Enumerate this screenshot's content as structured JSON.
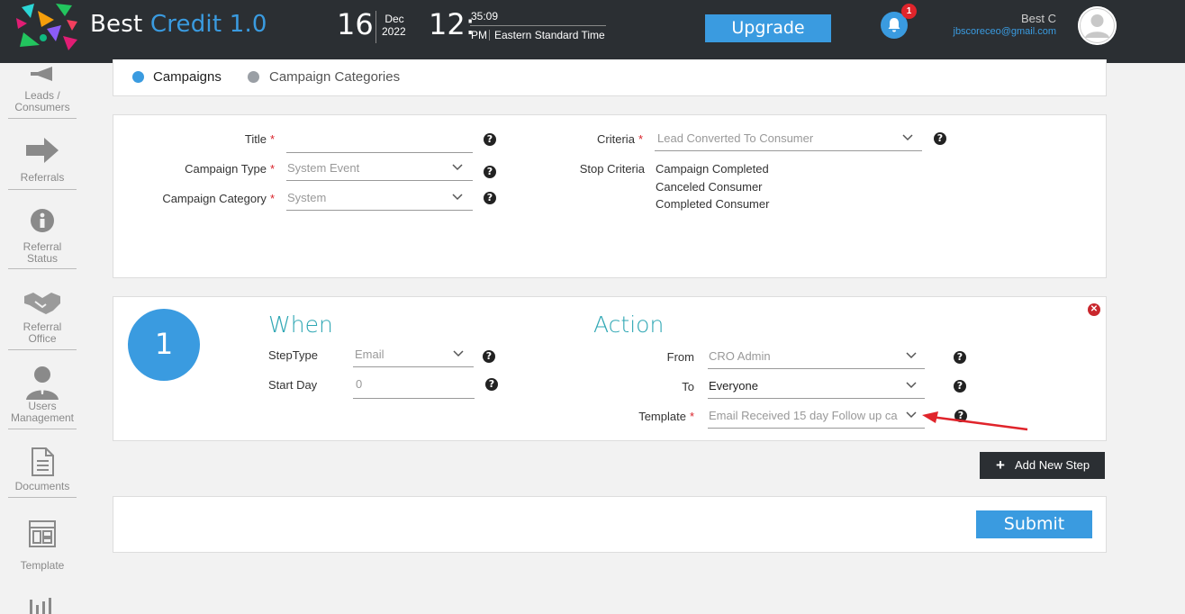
{
  "app": {
    "brand_part1": "Best ",
    "brand_part2": "Credit 1.0",
    "accent_color": "#3a9be0",
    "topbar_color": "#2b2f33"
  },
  "datetime": {
    "day": "16",
    "month": "Dec",
    "year": "2022",
    "hour": "12:",
    "min_sec": "35:09",
    "ampm": "PM",
    "timezone": "Eastern Standard Time"
  },
  "header": {
    "upgrade_label": "Upgrade",
    "notification_count": "1",
    "user_name": "Best C",
    "user_email": "jbscoreceo@gmail.com"
  },
  "sidebar": {
    "items": [
      {
        "label": "Leads / Consumers",
        "icon": "megaphone-icon"
      },
      {
        "label": "Referrals",
        "icon": "arrow-right-icon"
      },
      {
        "label": "Referral Status",
        "icon": "info-icon"
      },
      {
        "label": "Referral Office",
        "icon": "handshake-icon"
      },
      {
        "label": "Users Management",
        "icon": "user-icon"
      },
      {
        "label": "Documents",
        "icon": "document-icon"
      },
      {
        "label": "Template",
        "icon": "template-icon"
      },
      {
        "label": "",
        "icon": "bar-chart-icon"
      }
    ]
  },
  "tabs": [
    {
      "label": "Campaigns",
      "active": true,
      "color": "#3a9be0"
    },
    {
      "label": "Campaign Categories",
      "active": false,
      "color": "#9a9fa5"
    }
  ],
  "campaign_form": {
    "title_label": "Title",
    "title_value": "",
    "type_label": "Campaign Type",
    "type_value": "System Event",
    "category_label": "Campaign Category",
    "category_value": "System",
    "criteria_label": "Criteria",
    "criteria_value": "Lead Converted To Consumer",
    "stop_criteria_label": "Stop Criteria",
    "stop_criteria_items": [
      "Campaign Completed",
      "Canceled Consumer",
      "Completed Consumer"
    ],
    "required_mark": "*",
    "help_glyph": "?"
  },
  "step": {
    "number": "1",
    "when_title": "When",
    "action_title": "Action",
    "steptype_label": "StepType",
    "steptype_value": "Email",
    "startday_label": "Start Day",
    "startday_placeholder": "0",
    "from_label": "From",
    "from_value": "CRO Admin",
    "to_label": "To",
    "to_value": "Everyone",
    "template_label": "Template",
    "template_value": "Email Received 15 day Follow up ca",
    "close_glyph": "✕"
  },
  "actions": {
    "add_step_label": "Add New Step",
    "add_step_plus": "+",
    "submit_label": "Submit"
  }
}
